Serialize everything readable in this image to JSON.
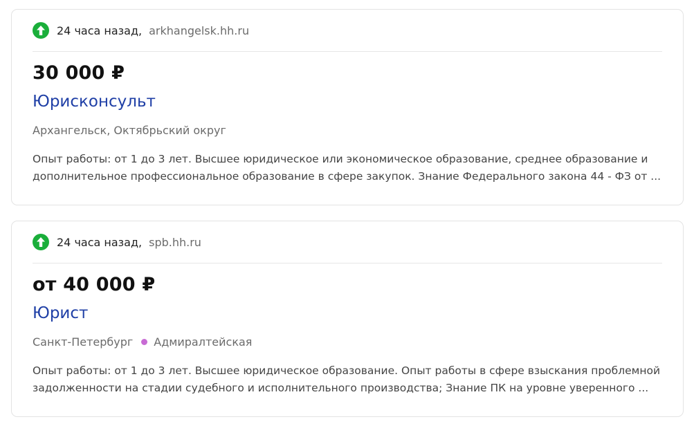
{
  "vacancies": [
    {
      "time": "24 часа назад",
      "comma": ",",
      "source": "arkhangelsk.hh.ru",
      "salary": "30 000 ₽",
      "title": "Юрисконсульт",
      "location": "Архангельск, Октябрьский округ",
      "metro": "",
      "description": [
        "Опыт работы: от 1 до 3 лет. Высшее юридическое или экономическое образование, среднее образование и",
        "дополнительное профессиональное образование в сфере закупок. Знание Федерального закона 44 - ФЗ от ..."
      ]
    },
    {
      "time": "24 часа назад",
      "comma": ",",
      "source": "spb.hh.ru",
      "salary": "от 40 000 ₽",
      "title": "Юрист",
      "location": "Санкт-Петербург",
      "metro": "Адмиралтейская",
      "description": [
        "Опыт работы: от 1 до 3 лет. Высшее юридическое образование. Опыт работы в сфере взыскания проблемной",
        "задолженности на стадии судебного и исполнительного производства; Знание ПК на уровне уверенного ..."
      ]
    }
  ],
  "colors": {
    "up_icon": "#1aae3a",
    "title_link": "#1f3fa6",
    "metro_line": "#c86bd4"
  },
  "icons": {
    "freshness": "arrow-up-circle-icon",
    "metro": "metro-line-dot-icon"
  }
}
